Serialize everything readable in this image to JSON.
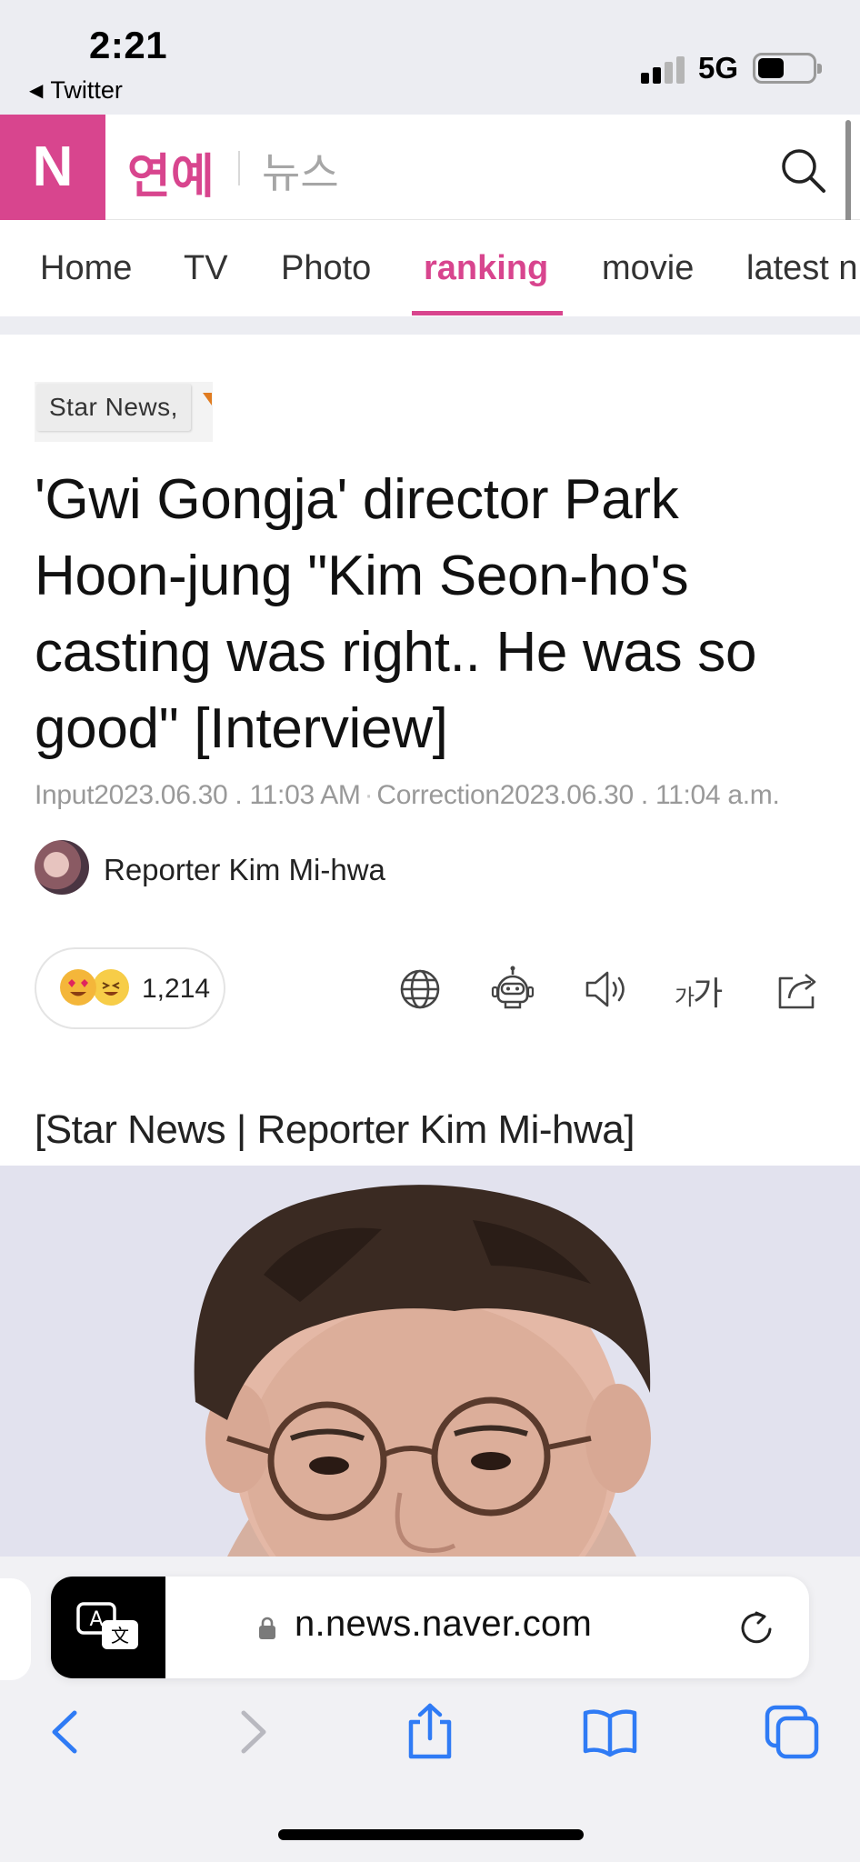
{
  "status_bar": {
    "time": "2:21",
    "back_app": "Twitter",
    "network": "5G"
  },
  "header": {
    "logo": "N",
    "section_title": "연예",
    "section_subtitle": "뉴스",
    "brand_color": "#d8458e"
  },
  "tabs": [
    {
      "label": "Home",
      "active": false
    },
    {
      "label": "TV",
      "active": false
    },
    {
      "label": "Photo",
      "active": false
    },
    {
      "label": "ranking",
      "active": true
    },
    {
      "label": "movie",
      "active": false
    },
    {
      "label": "latest n",
      "active": false
    }
  ],
  "article": {
    "press": "Star News,",
    "headline": "'Gwi Gongja' director Park Hoon-jung \"Kim Seon-ho's casting was right.. He was so good\" [Interview]",
    "input_label": "Input",
    "input_time": "2023.06.30 . 11:03 AM",
    "correction_label": "Correction",
    "correction_time": "2023.06.30 . 11:04 a.m.",
    "reporter": "Reporter Kim Mi-hwa",
    "reaction_count": "1,214",
    "font_size_label_small": "가",
    "font_size_label_large": "가",
    "caption": "[Star News | Reporter Kim Mi-hwa]"
  },
  "browser": {
    "url": "n.news.naver.com"
  }
}
